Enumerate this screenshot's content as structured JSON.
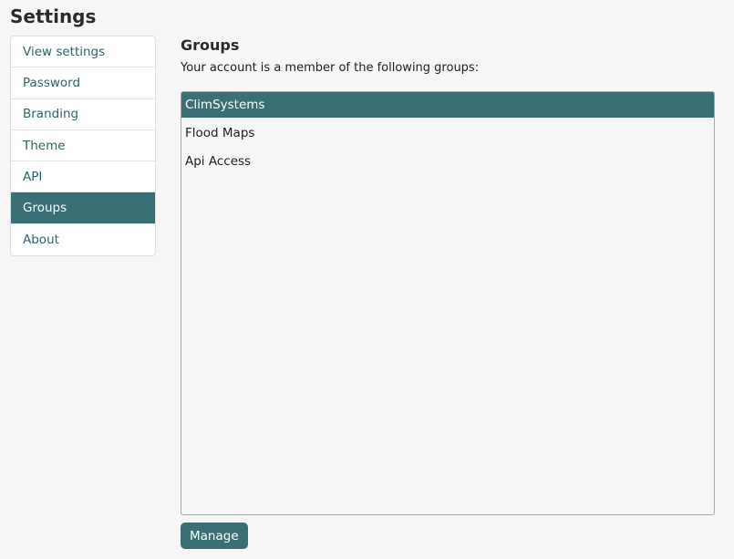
{
  "page": {
    "title": "Settings"
  },
  "sidebar": {
    "items": [
      {
        "label": "View settings"
      },
      {
        "label": "Password"
      },
      {
        "label": "Branding"
      },
      {
        "label": "Theme"
      },
      {
        "label": "API"
      },
      {
        "label": "Groups"
      },
      {
        "label": "About"
      }
    ],
    "active_item": "Groups"
  },
  "main": {
    "title": "Groups",
    "description": "Your account is a member of the following groups:",
    "groups": [
      {
        "name": "ClimSystems"
      },
      {
        "name": "Flood Maps"
      },
      {
        "name": "Api Access"
      }
    ],
    "selected_group": "ClimSystems",
    "manage_label": "Manage"
  },
  "colors": {
    "accent": "#3a7075",
    "link": "#2f6369",
    "background": "#f6f6f6"
  }
}
